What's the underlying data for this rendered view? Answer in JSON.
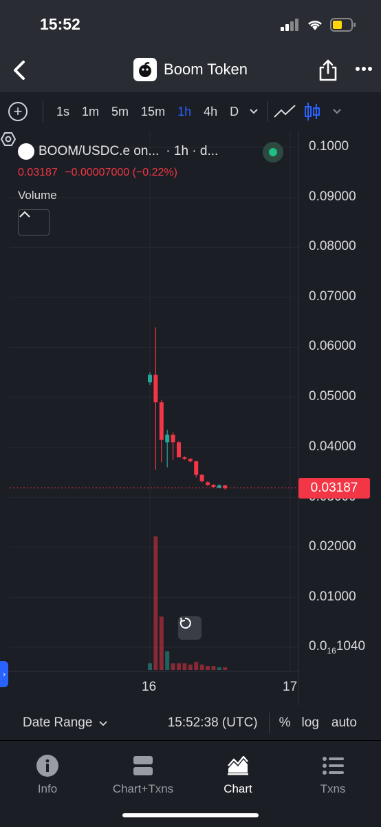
{
  "status_bar": {
    "time": "15:52"
  },
  "nav": {
    "title": "Boom Token",
    "back_icon": "chevron-left-icon",
    "share_icon": "share-icon",
    "more_icon": "more-icon"
  },
  "toolbar": {
    "timeframes": [
      "1s",
      "1m",
      "5m",
      "15m",
      "1h",
      "4h",
      "D"
    ],
    "active_timeframe": "1h",
    "accent": "#2962ff"
  },
  "legend": {
    "symbol": "BOOM/USDC.e on...",
    "interval": "· 1h · d...",
    "price": "0.03187",
    "change": "−0.00007000 (−0.22%)",
    "volume_label": "Volume"
  },
  "price_axis": {
    "labels": [
      "0.1000",
      "0.09000",
      "0.08000",
      "0.07000",
      "0.06000",
      "0.05000",
      "0.04000",
      "0.03000",
      "0.02000",
      "0.01000"
    ],
    "last_label_prefix": "0.0",
    "last_label_sub": "16",
    "last_label_suffix": "1040",
    "current_price_tag": "0.03187"
  },
  "time_axis": {
    "labels": [
      "16",
      "17"
    ]
  },
  "footer": {
    "date_range": "Date Range",
    "clock": "15:52:38 (UTC)",
    "percent": "%",
    "log": "log",
    "auto": "auto"
  },
  "tabs": [
    {
      "label": "Info",
      "icon": "info-icon"
    },
    {
      "label": "Chart+Txns",
      "icon": "split-icon"
    },
    {
      "label": "Chart",
      "icon": "chart-icon"
    },
    {
      "label": "Txns",
      "icon": "list-icon"
    }
  ],
  "active_tab": "Chart",
  "colors": {
    "up": "#26a69a",
    "down": "#f23645",
    "background": "#1c1e25"
  },
  "chart_data": {
    "type": "candlestick",
    "price_ylim": [
      0.0,
      0.1
    ],
    "candles": [
      {
        "o": 0.053,
        "h": 0.055,
        "l": 0.0525,
        "c": 0.0545
      },
      {
        "o": 0.0545,
        "h": 0.064,
        "l": 0.0355,
        "c": 0.049
      },
      {
        "o": 0.049,
        "h": 0.0495,
        "l": 0.037,
        "c": 0.0415
      },
      {
        "o": 0.041,
        "h": 0.0435,
        "l": 0.036,
        "c": 0.0425
      },
      {
        "o": 0.0425,
        "h": 0.043,
        "l": 0.0375,
        "c": 0.041
      },
      {
        "o": 0.041,
        "h": 0.0412,
        "l": 0.038,
        "c": 0.038
      },
      {
        "o": 0.038,
        "h": 0.0382,
        "l": 0.0375,
        "c": 0.0377
      },
      {
        "o": 0.0377,
        "h": 0.0378,
        "l": 0.037,
        "c": 0.0372
      },
      {
        "o": 0.0372,
        "h": 0.0373,
        "l": 0.034,
        "c": 0.0345
      },
      {
        "o": 0.0345,
        "h": 0.0346,
        "l": 0.033,
        "c": 0.0332
      },
      {
        "o": 0.033,
        "h": 0.0332,
        "l": 0.0322,
        "c": 0.0325
      },
      {
        "o": 0.0325,
        "h": 0.0326,
        "l": 0.032,
        "c": 0.0321
      },
      {
        "o": 0.0319,
        "h": 0.0326,
        "l": 0.0318,
        "c": 0.0324
      },
      {
        "o": 0.0324,
        "h": 0.0325,
        "l": 0.0315,
        "c": 0.0318
      }
    ],
    "volume": [
      5,
      100,
      40,
      14,
      5,
      5,
      5,
      4,
      6,
      4,
      3,
      3,
      2,
      2
    ]
  }
}
